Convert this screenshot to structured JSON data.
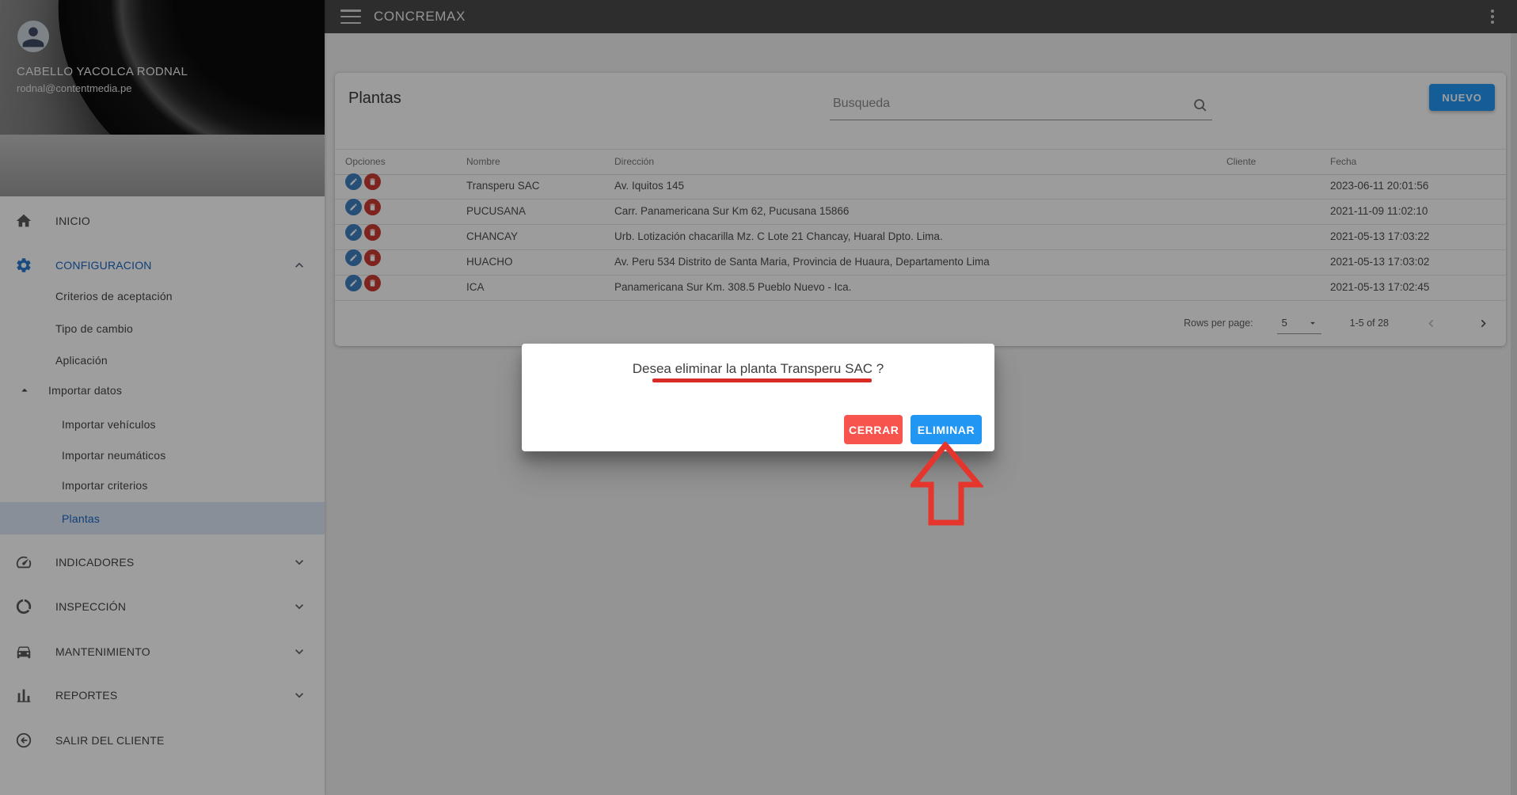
{
  "topbar": {
    "title": "CONCREMAX"
  },
  "user": {
    "name": "CABELLO YACOLCA RODNAL",
    "email": "rodnal@contentmedia.pe"
  },
  "sidebar": {
    "inicio": "INICIO",
    "configuracion": "CONFIGURACION",
    "criterios": "Criterios de aceptación",
    "tipo_cambio": "Tipo de cambio",
    "aplicacion": "Aplicación",
    "importar_datos": "Importar datos",
    "importar_vehiculos": "Importar vehículos",
    "importar_neumaticos": "Importar neumáticos",
    "importar_criterios": "Importar criterios",
    "plantas": "Plantas",
    "indicadores": "INDICADORES",
    "inspeccion": "INSPECCIÓN",
    "mantenimiento": "MANTENIMIENTO",
    "reportes": "REPORTES",
    "salir": "SALIR DEL CLIENTE",
    "selected_item": "Plantas"
  },
  "card": {
    "title": "Plantas",
    "search_placeholder": "Busqueda",
    "search_value": "",
    "new_button": "NUEVO"
  },
  "table": {
    "columns": [
      "Opciones",
      "Nombre",
      "Dirección",
      "Cliente",
      "Fecha"
    ],
    "rows": [
      {
        "nombre": "Transperu SAC",
        "direccion": "Av. Iquitos 145",
        "cliente": "",
        "fecha": "2023-06-11 20:01:56"
      },
      {
        "nombre": "PUCUSANA",
        "direccion": "Carr. Panamericana Sur Km 62, Pucusana 15866",
        "cliente": "",
        "fecha": "2021-11-09 11:02:10"
      },
      {
        "nombre": "CHANCAY",
        "direccion": "Urb. Lotización chacarilla Mz. C Lote 21 Chancay, Huaral Dpto. Lima.",
        "cliente": "",
        "fecha": "2021-05-13 17:03:22"
      },
      {
        "nombre": "HUACHO",
        "direccion": "Av. Peru 534 Distrito de Santa Maria, Provincia de Huaura, Departamento Lima",
        "cliente": "",
        "fecha": "2021-05-13 17:03:02"
      },
      {
        "nombre": "ICA",
        "direccion": "Panamericana Sur Km. 308.5 Pueblo Nuevo - Ica.",
        "cliente": "",
        "fecha": "2021-05-13 17:02:45"
      }
    ]
  },
  "pagination": {
    "rows_per_page_label": "Rows per page:",
    "rows_per_page_value": "5",
    "range": "1-5 of 28"
  },
  "dialog": {
    "message": "Desea eliminar la planta Transperu SAC ?",
    "cerrar": "CERRAR",
    "eliminar": "ELIMINAR"
  },
  "icons": {
    "hamburger": "three-bars",
    "kebab": "vertical-dots",
    "search": "magnifier",
    "home": "house",
    "configuracion": "gear",
    "indicadores": "gauge",
    "inspeccion": "donut-segments",
    "mantenimiento": "car",
    "reportes": "bar-chart",
    "salir": "circle-arrow-left",
    "edit": "pencil-in-blue-circle",
    "delete": "trash-in-red-circle",
    "expand": "chevron-down",
    "collapse": "chevron-up",
    "importar_caret": "caret-up",
    "annotation": "hollow-red-up-arrow"
  },
  "colors": {
    "accent_blue": "#2196f3",
    "link_blue": "#1a66c4",
    "cerrar_red": "#f8544e",
    "delete_red": "#cc3a31",
    "annotation_red": "#d92b25",
    "topbar_gray": "#4a4a4a"
  }
}
